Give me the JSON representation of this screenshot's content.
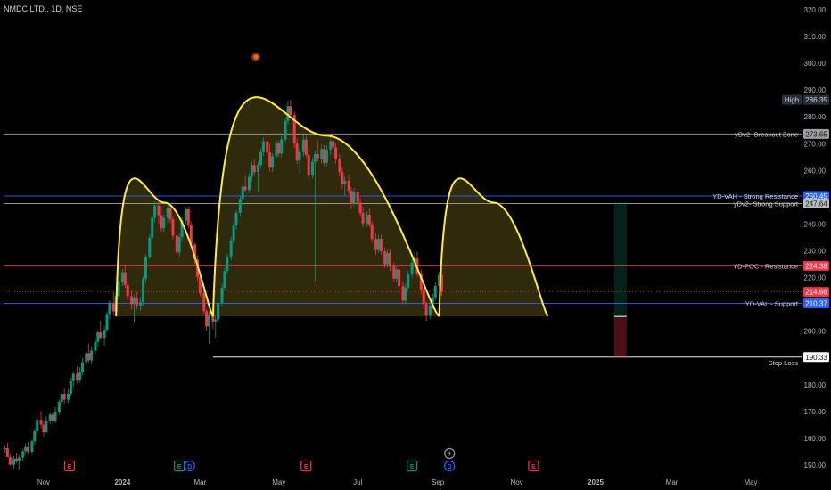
{
  "header": {
    "symbol_line": "NMDC LTD., 1D, NSE"
  },
  "chart_data": {
    "type": "candlestick",
    "ylim": [
      145,
      321
    ],
    "y_ticks": [
      150,
      160,
      170,
      180,
      190,
      200,
      210,
      220,
      230,
      240,
      250,
      260,
      270,
      280,
      290,
      300,
      310,
      320
    ],
    "x_ticks": [
      "Nov",
      "2024",
      "Mar",
      "May",
      "Jul",
      "Sep",
      "Nov",
      "2025",
      "Mar",
      "May"
    ],
    "levels": [
      {
        "name": "yDv2- Breakout Zone",
        "value": 273.65,
        "line_color": "#9e9e9e",
        "badge_bg": "#9e9e9e",
        "badge_fg": "#131722"
      },
      {
        "name": "YD-VAH - Strong Resistance",
        "value": 250.45,
        "line_color": "#2962ff",
        "badge_bg": "#2962ff",
        "badge_fg": "#ffffff"
      },
      {
        "name": "yDv2- Strong Support",
        "value": 247.64,
        "line_color": "#9e9e9e",
        "badge_bg": "#bdbdbd",
        "badge_fg": "#131722"
      },
      {
        "name": "YD-POC - Resistance",
        "value": 224.38,
        "line_color": "#f23645",
        "badge_bg": "#f23645",
        "badge_fg": "#ffffff"
      },
      {
        "name": "YD-VAL - Support",
        "value": 210.37,
        "line_color": "#2962ff",
        "badge_bg": "#2962ff",
        "badge_fg": "#ffffff"
      },
      {
        "name": "Stop Loss",
        "value": 190.33,
        "line_color": "#ffffff",
        "badge_bg": "#ffffff",
        "badge_fg": "#131722"
      }
    ],
    "current_price": {
      "value": 214.66,
      "color": "#f23645"
    },
    "high_marker": {
      "label": "High",
      "value": 286.35
    },
    "pattern": {
      "description_color": "#ffeb3b",
      "neckline": 205.5,
      "arcs": [
        {
          "from": "2023-12-27",
          "to": "2024-03-11",
          "peak": 248
        },
        {
          "from": "2024-03-11",
          "to": "2024-09-02",
          "peak": 273
        },
        {
          "from": "2024-09-02",
          "to": "2024-11-25",
          "peak": 248
        }
      ]
    },
    "events": [
      {
        "date": "2023-11-21",
        "type": "E",
        "color": "#f23645"
      },
      {
        "date": "2024-02-14",
        "type": "E",
        "color": "#089981"
      },
      {
        "date": "2024-02-22",
        "type": "D",
        "color": "#2962ff"
      },
      {
        "date": "2024-05-22",
        "type": "E",
        "color": "#f23645"
      },
      {
        "date": "2024-08-12",
        "type": "E",
        "color": "#089981"
      },
      {
        "date": "2024-09-10",
        "type": "D",
        "color": "#2962ff"
      },
      {
        "date": "2024-11-14",
        "type": "E",
        "color": "#f23645"
      }
    ],
    "split_marker": {
      "date": "2024-09-10",
      "icon": "lightning-icon"
    },
    "position_box": {
      "date": "2025-01-25",
      "entry": 205.5,
      "target": 248,
      "stop": 190.33
    },
    "ohlc": [
      [
        "2023-10-02",
        155.9,
        157.0,
        154.6,
        156.3
      ],
      [
        "2023-10-04",
        156.3,
        158.4,
        154.7,
        153.0
      ],
      [
        "2023-10-06",
        153.0,
        154.2,
        149.8,
        150.1
      ],
      [
        "2023-10-09",
        150.1,
        153.4,
        148.6,
        152.4
      ],
      [
        "2023-10-11",
        152.4,
        154.4,
        150.8,
        151.7
      ],
      [
        "2023-10-13",
        151.7,
        153.6,
        148.4,
        152.8
      ],
      [
        "2023-10-16",
        152.8,
        156.1,
        151.4,
        155.2
      ],
      [
        "2023-10-18",
        155.2,
        158.1,
        153.9,
        156.7
      ],
      [
        "2023-10-20",
        156.7,
        158.6,
        153.9,
        155.0
      ],
      [
        "2023-10-23",
        155.0,
        159.4,
        154.0,
        158.9
      ],
      [
        "2023-10-25",
        158.9,
        163.5,
        157.6,
        162.6
      ],
      [
        "2023-10-27",
        162.6,
        167.8,
        162.1,
        166.9
      ],
      [
        "2023-10-30",
        166.9,
        170.1,
        163.8,
        165.1
      ],
      [
        "2023-11-01",
        165.1,
        166.8,
        160.6,
        162.3
      ],
      [
        "2023-11-03",
        162.3,
        168.4,
        161.8,
        166.5
      ],
      [
        "2023-11-06",
        166.5,
        169.5,
        165.3,
        168.8
      ],
      [
        "2023-11-08",
        168.8,
        170.1,
        165.0,
        166.4
      ],
      [
        "2023-11-10",
        166.4,
        171.7,
        165.6,
        169.9
      ],
      [
        "2023-11-13",
        169.9,
        174.4,
        168.8,
        173.6
      ],
      [
        "2023-11-15",
        173.6,
        177.9,
        172.4,
        176.6
      ],
      [
        "2023-11-17",
        176.6,
        178.5,
        172.8,
        174.4
      ],
      [
        "2023-11-20",
        174.4,
        178.3,
        173.2,
        176.6
      ],
      [
        "2023-11-22",
        176.6,
        182.7,
        175.5,
        181.3
      ],
      [
        "2023-11-24",
        181.3,
        185.0,
        179.4,
        184.1
      ],
      [
        "2023-11-27",
        184.1,
        186.9,
        180.6,
        181.9
      ],
      [
        "2023-11-29",
        181.9,
        186.6,
        180.8,
        184.8
      ],
      [
        "2023-12-01",
        184.8,
        189.9,
        183.5,
        188.4
      ],
      [
        "2023-12-04",
        188.4,
        192.6,
        187.2,
        191.8
      ],
      [
        "2023-12-06",
        191.8,
        195.4,
        188.3,
        189.1
      ],
      [
        "2023-12-08",
        189.1,
        194.2,
        187.6,
        192.7
      ],
      [
        "2023-12-11",
        192.7,
        197.6,
        191.6,
        196.0
      ],
      [
        "2023-12-13",
        196.0,
        200.4,
        194.2,
        199.5
      ],
      [
        "2023-12-15",
        199.5,
        203.9,
        196.8,
        197.5
      ],
      [
        "2023-12-18",
        197.5,
        201.8,
        194.5,
        200.5
      ],
      [
        "2023-12-20",
        200.5,
        207.4,
        199.6,
        206.1
      ],
      [
        "2023-12-22",
        206.1,
        211.5,
        204.4,
        210.6
      ],
      [
        "2023-12-25",
        210.6,
        214.5,
        205.9,
        207.4
      ],
      [
        "2023-12-27",
        207.4,
        214.7,
        206.0,
        213.2
      ],
      [
        "2023-12-29",
        213.2,
        219.6,
        211.8,
        218.4
      ],
      [
        "2024-01-01",
        218.4,
        223.2,
        216.8,
        222.0
      ],
      [
        "2024-01-03",
        222.0,
        224.9,
        216.2,
        217.2
      ],
      [
        "2024-01-05",
        217.2,
        218.6,
        211.5,
        213.0
      ],
      [
        "2024-01-08",
        213.0,
        215.0,
        208.2,
        210.1
      ],
      [
        "2024-01-10",
        210.1,
        213.6,
        203.4,
        212.4
      ],
      [
        "2024-01-12",
        212.4,
        214.6,
        208.2,
        209.4
      ],
      [
        "2024-01-15",
        209.4,
        212.8,
        207.7,
        211.0
      ],
      [
        "2024-01-17",
        211.0,
        220.4,
        209.6,
        219.6
      ],
      [
        "2024-01-19",
        219.6,
        228.8,
        218.0,
        227.7
      ],
      [
        "2024-01-22",
        227.7,
        236.2,
        226.9,
        234.9
      ],
      [
        "2024-01-24",
        234.9,
        243.5,
        233.6,
        242.4
      ],
      [
        "2024-01-26",
        242.4,
        248.4,
        240.7,
        246.9
      ],
      [
        "2024-01-29",
        246.9,
        249.0,
        240.1,
        243.3
      ],
      [
        "2024-01-31",
        243.3,
        246.8,
        237.1,
        238.4
      ],
      [
        "2024-02-02",
        238.4,
        243.6,
        237.1,
        242.3
      ],
      [
        "2024-02-05",
        242.3,
        247.9,
        240.6,
        246.1
      ],
      [
        "2024-02-07",
        246.1,
        247.1,
        240.4,
        241.8
      ],
      [
        "2024-02-09",
        241.8,
        242.9,
        234.3,
        235.7
      ],
      [
        "2024-02-12",
        235.7,
        237.3,
        228.0,
        229.4
      ],
      [
        "2024-02-14",
        229.4,
        236.6,
        227.8,
        235.1
      ],
      [
        "2024-02-16",
        235.1,
        242.5,
        233.7,
        241.3
      ],
      [
        "2024-02-19",
        241.3,
        246.3,
        239.8,
        245.5
      ],
      [
        "2024-02-21",
        245.5,
        246.6,
        238.4,
        239.6
      ],
      [
        "2024-02-23",
        239.6,
        240.9,
        231.5,
        232.4
      ],
      [
        "2024-02-26",
        232.4,
        233.1,
        225.1,
        226.7
      ],
      [
        "2024-02-28",
        226.7,
        228.4,
        218.7,
        220.3
      ],
      [
        "2024-03-01",
        220.3,
        221.6,
        212.9,
        214.1
      ],
      [
        "2024-03-04",
        214.1,
        215.7,
        206.2,
        207.5
      ],
      [
        "2024-03-06",
        207.5,
        208.3,
        200.2,
        201.8
      ],
      [
        "2024-03-08",
        201.8,
        207.4,
        195.5,
        205.9
      ],
      [
        "2024-03-11",
        205.9,
        207.3,
        200.8,
        203.6
      ],
      [
        "2024-03-13",
        203.6,
        205.9,
        197.5,
        204.4
      ],
      [
        "2024-03-15",
        204.4,
        211.9,
        203.1,
        210.6
      ],
      [
        "2024-03-18",
        210.6,
        217.7,
        209.4,
        216.2
      ],
      [
        "2024-03-20",
        216.2,
        223.8,
        215.0,
        222.5
      ],
      [
        "2024-03-22",
        222.5,
        229.0,
        221.4,
        227.9
      ],
      [
        "2024-03-25",
        227.9,
        235.3,
        226.4,
        233.7
      ],
      [
        "2024-03-27",
        233.7,
        240.3,
        232.6,
        239.5
      ],
      [
        "2024-03-29",
        239.5,
        245.0,
        237.8,
        244.2
      ],
      [
        "2024-04-01",
        244.2,
        250.6,
        242.7,
        249.4
      ],
      [
        "2024-04-03",
        249.4,
        255.2,
        247.8,
        254.0
      ],
      [
        "2024-04-05",
        254.0,
        258.4,
        251.9,
        252.7
      ],
      [
        "2024-04-08",
        252.7,
        258.9,
        251.5,
        257.6
      ],
      [
        "2024-04-10",
        257.6,
        263.4,
        255.8,
        262.0
      ],
      [
        "2024-04-12",
        262.0,
        264.1,
        258.4,
        259.4
      ],
      [
        "2024-04-15",
        259.4,
        263.2,
        251.8,
        262.1
      ],
      [
        "2024-04-17",
        262.1,
        268.3,
        260.8,
        266.8
      ],
      [
        "2024-04-19",
        266.8,
        272.4,
        265.5,
        270.9
      ],
      [
        "2024-04-22",
        270.9,
        273.6,
        265.4,
        266.7
      ],
      [
        "2024-04-24",
        266.7,
        270.0,
        259.7,
        261.1
      ],
      [
        "2024-04-26",
        261.1,
        266.5,
        259.5,
        265.3
      ],
      [
        "2024-04-29",
        265.3,
        271.6,
        264.2,
        270.2
      ],
      [
        "2024-05-01",
        270.2,
        271.2,
        265.1,
        266.3
      ],
      [
        "2024-05-03",
        266.3,
        273.0,
        264.9,
        271.6
      ],
      [
        "2024-05-06",
        271.6,
        279.7,
        270.4,
        278.5
      ],
      [
        "2024-05-08",
        278.5,
        286.1,
        277.3,
        284.0
      ],
      [
        "2024-05-10",
        284.0,
        286.4,
        279.4,
        280.7
      ],
      [
        "2024-05-13",
        280.7,
        282.1,
        268.4,
        270.3
      ],
      [
        "2024-05-15",
        270.3,
        272.0,
        262.4,
        263.7
      ],
      [
        "2024-05-17",
        263.7,
        268.5,
        258.9,
        266.9
      ],
      [
        "2024-05-20",
        266.9,
        273.2,
        265.2,
        271.5
      ],
      [
        "2024-05-22",
        271.5,
        272.9,
        264.7,
        265.8
      ],
      [
        "2024-05-24",
        265.8,
        268.3,
        256.6,
        258.4
      ],
      [
        "2024-05-27",
        258.4,
        264.8,
        257.1,
        263.3
      ],
      [
        "2024-05-29",
        263.3,
        267.6,
        218.6,
        266.1
      ],
      [
        "2024-05-31",
        266.1,
        270.9,
        263.4,
        264.2
      ],
      [
        "2024-06-03",
        264.2,
        269.6,
        262.5,
        268.0
      ],
      [
        "2024-06-05",
        268.0,
        269.4,
        261.7,
        262.9
      ],
      [
        "2024-06-07",
        262.9,
        269.3,
        261.6,
        267.8
      ],
      [
        "2024-06-10",
        267.8,
        272.5,
        265.9,
        271.0
      ],
      [
        "2024-06-12",
        271.0,
        275.1,
        267.7,
        268.6
      ],
      [
        "2024-06-14",
        268.6,
        270.4,
        262.6,
        264.3
      ],
      [
        "2024-06-17",
        264.3,
        266.1,
        257.8,
        259.4
      ],
      [
        "2024-06-19",
        259.4,
        261.2,
        253.2,
        254.8
      ],
      [
        "2024-06-21",
        254.8,
        258.0,
        250.7,
        256.1
      ],
      [
        "2024-06-24",
        256.1,
        258.5,
        251.2,
        252.4
      ],
      [
        "2024-06-26",
        252.4,
        253.9,
        245.5,
        247.6
      ],
      [
        "2024-06-28",
        247.6,
        253.5,
        246.5,
        252.0
      ],
      [
        "2024-07-01",
        252.0,
        253.2,
        246.3,
        248.0
      ],
      [
        "2024-07-03",
        248.0,
        249.7,
        242.6,
        244.1
      ],
      [
        "2024-07-05",
        244.1,
        246.4,
        238.9,
        240.2
      ],
      [
        "2024-07-08",
        240.2,
        244.7,
        239.0,
        243.5
      ],
      [
        "2024-07-10",
        243.5,
        245.9,
        238.8,
        239.9
      ],
      [
        "2024-07-12",
        239.9,
        241.1,
        233.1,
        234.4
      ],
      [
        "2024-07-15",
        234.4,
        236.6,
        228.5,
        230.3
      ],
      [
        "2024-07-17",
        230.3,
        235.9,
        229.2,
        234.5
      ],
      [
        "2024-07-19",
        234.5,
        236.0,
        228.6,
        229.8
      ],
      [
        "2024-07-22",
        229.8,
        231.3,
        223.6,
        225.0
      ],
      [
        "2024-07-24",
        225.0,
        230.6,
        223.7,
        229.2
      ],
      [
        "2024-07-26",
        229.2,
        230.4,
        222.4,
        224.1
      ],
      [
        "2024-07-29",
        224.1,
        225.7,
        218.5,
        219.6
      ],
      [
        "2024-07-31",
        219.6,
        224.1,
        218.4,
        223.0
      ],
      [
        "2024-08-02",
        223.0,
        224.6,
        215.1,
        216.8
      ],
      [
        "2024-08-05",
        216.8,
        218.6,
        210.0,
        211.4
      ],
      [
        "2024-08-07",
        211.4,
        217.7,
        210.1,
        216.3
      ],
      [
        "2024-08-09",
        216.3,
        222.5,
        215.1,
        221.2
      ],
      [
        "2024-08-12",
        221.2,
        227.0,
        219.8,
        225.6
      ],
      [
        "2024-08-14",
        225.6,
        229.9,
        224.1,
        227.1
      ],
      [
        "2024-08-16",
        227.1,
        229.7,
        220.3,
        221.6
      ],
      [
        "2024-08-19",
        221.6,
        223.1,
        213.6,
        215.2
      ],
      [
        "2024-08-21",
        215.2,
        216.4,
        208.3,
        210.1
      ],
      [
        "2024-08-23",
        210.1,
        211.2,
        203.9,
        205.8
      ],
      [
        "2024-08-26",
        205.8,
        210.9,
        204.6,
        209.6
      ],
      [
        "2024-08-28",
        209.6,
        213.9,
        208.1,
        212.7
      ],
      [
        "2024-08-30",
        212.7,
        218.3,
        211.3,
        216.9
      ],
      [
        "2024-09-02",
        216.9,
        222.2,
        215.7,
        221.0
      ],
      [
        "2024-09-04",
        221.0,
        223.5,
        213.2,
        214.7
      ]
    ]
  }
}
